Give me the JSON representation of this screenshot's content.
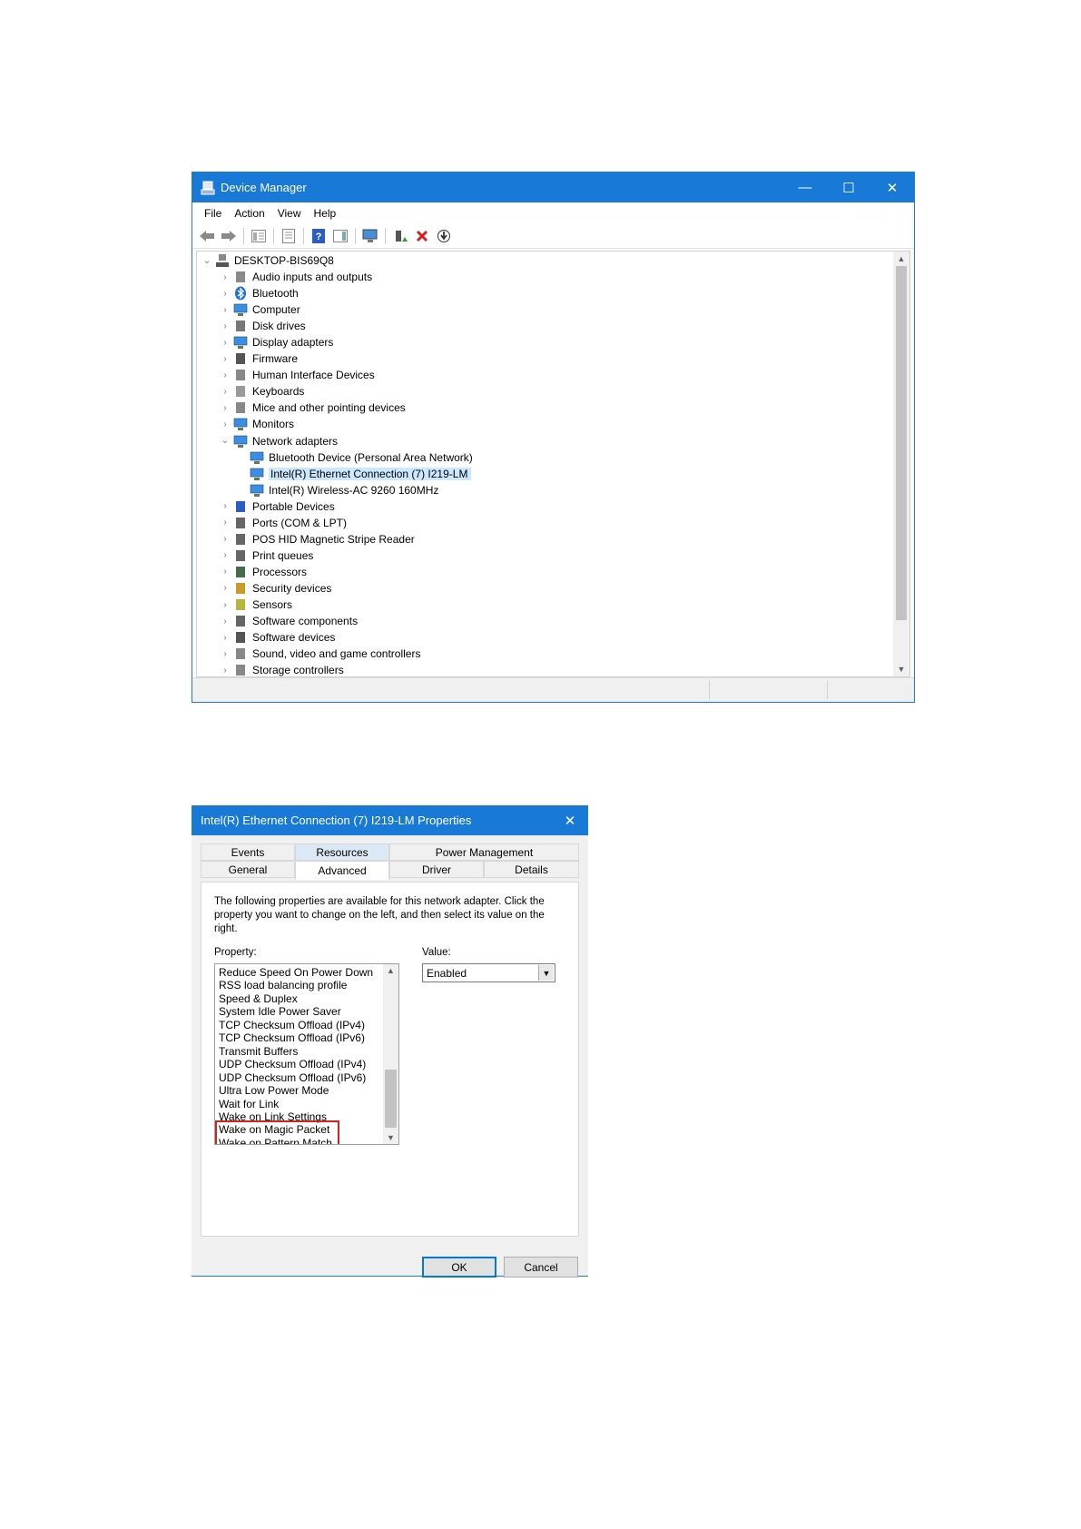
{
  "device_manager": {
    "title": "Device Manager",
    "controls": {
      "minimize": "—",
      "maximize": "☐",
      "close": "✕"
    },
    "menu": [
      "File",
      "Action",
      "View",
      "Help"
    ],
    "tree": {
      "root": "DESKTOP-BIS69Q8",
      "items": [
        {
          "label": "Audio inputs and outputs",
          "icon": "speaker-icon",
          "expanded": false
        },
        {
          "label": "Bluetooth",
          "icon": "bluetooth-icon",
          "expanded": false
        },
        {
          "label": "Computer",
          "icon": "computer-icon",
          "expanded": false
        },
        {
          "label": "Disk drives",
          "icon": "disk-icon",
          "expanded": false
        },
        {
          "label": "Display adapters",
          "icon": "display-adapter-icon",
          "expanded": false
        },
        {
          "label": "Firmware",
          "icon": "firmware-icon",
          "expanded": false
        },
        {
          "label": "Human Interface Devices",
          "icon": "hid-icon",
          "expanded": false
        },
        {
          "label": "Keyboards",
          "icon": "keyboard-icon",
          "expanded": false
        },
        {
          "label": "Mice and other pointing devices",
          "icon": "mouse-icon",
          "expanded": false
        },
        {
          "label": "Monitors",
          "icon": "monitor-icon",
          "expanded": false
        },
        {
          "label": "Network adapters",
          "icon": "network-icon",
          "expanded": true
        },
        {
          "label": "Bluetooth Device (Personal Area Network)",
          "icon": "network-adapter-icon",
          "child": true
        },
        {
          "label": "Intel(R) Ethernet Connection (7) I219-LM",
          "icon": "network-adapter-icon",
          "child": true,
          "selected": true
        },
        {
          "label": "Intel(R) Wireless-AC 9260 160MHz",
          "icon": "network-adapter-icon",
          "child": true
        },
        {
          "label": "Portable Devices",
          "icon": "portable-device-icon",
          "expanded": false
        },
        {
          "label": "Ports (COM & LPT)",
          "icon": "port-icon",
          "expanded": false
        },
        {
          "label": "POS HID Magnetic Stripe Reader",
          "icon": "card-reader-icon",
          "expanded": false
        },
        {
          "label": "Print queues",
          "icon": "printer-icon",
          "expanded": false
        },
        {
          "label": "Processors",
          "icon": "processor-icon",
          "expanded": false
        },
        {
          "label": "Security devices",
          "icon": "security-icon",
          "expanded": false
        },
        {
          "label": "Sensors",
          "icon": "sensor-icon",
          "expanded": false
        },
        {
          "label": "Software components",
          "icon": "software-component-icon",
          "expanded": false
        },
        {
          "label": "Software devices",
          "icon": "software-device-icon",
          "expanded": false
        },
        {
          "label": "Sound, video and game controllers",
          "icon": "sound-icon",
          "expanded": false
        },
        {
          "label": "Storage controllers",
          "icon": "storage-icon",
          "expanded": false
        }
      ]
    }
  },
  "properties": {
    "title": "Intel(R) Ethernet Connection (7) I219-LM Properties",
    "close": "✕",
    "tabs_upper": [
      "Events",
      "Resources",
      "Power Management"
    ],
    "tabs_lower": [
      "General",
      "Advanced",
      "Driver",
      "Details"
    ],
    "active_tab": "Advanced",
    "description": "The following properties are available for this network adapter. Click the property you want to change on the left, and then select its value on the right.",
    "property_label": "Property:",
    "value_label": "Value:",
    "properties_list": [
      "Reduce Speed On Power Down",
      "RSS load balancing profile",
      "Speed & Duplex",
      "System Idle Power Saver",
      "TCP Checksum Offload (IPv4)",
      "TCP Checksum Offload (IPv6)",
      "Transmit Buffers",
      "UDP Checksum Offload (IPv4)",
      "UDP Checksum Offload (IPv6)",
      "Ultra Low Power Mode",
      "Wait for Link",
      "Wake on Link Settings",
      "Wake on Magic Packet",
      "Wake on Pattern Match"
    ],
    "highlighted": [
      "Wake on Magic Packet",
      "Wake on Pattern Match"
    ],
    "highlight_color": "#d42323",
    "value_selected": "Enabled",
    "ok_label": "OK",
    "cancel_label": "Cancel"
  },
  "colors": {
    "titlebar": "#1979d6",
    "selection": "#cce8ff"
  }
}
